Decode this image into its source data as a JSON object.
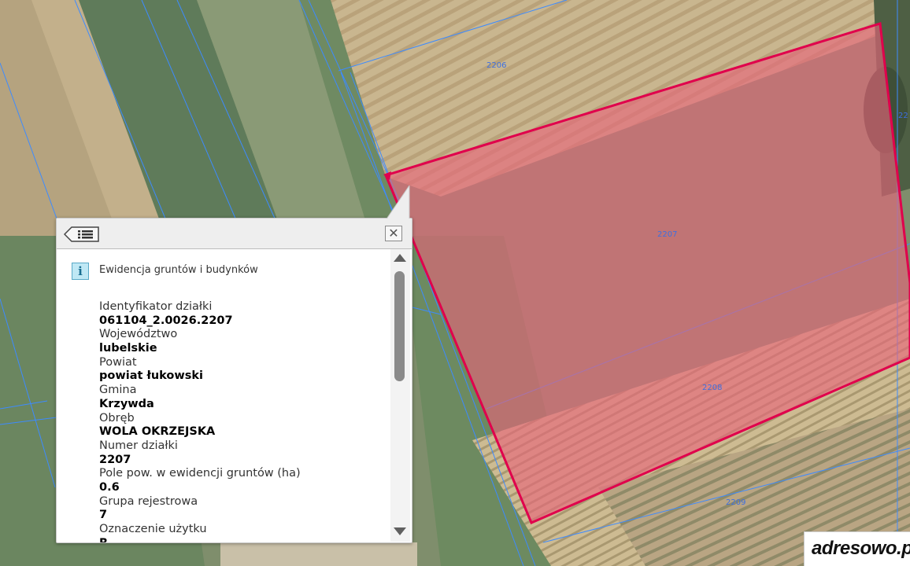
{
  "map": {
    "parcel_labels": [
      {
        "id": "label-2206-top",
        "text": "2206"
      },
      {
        "id": "label-2207",
        "text": "2207"
      },
      {
        "id": "label-2208",
        "text": "2208"
      },
      {
        "id": "label-2209",
        "text": "2209"
      },
      {
        "id": "label-22-edge",
        "text": "22"
      }
    ],
    "colors": {
      "highlight_fill": "#e8647a",
      "highlight_stroke": "#e0004c",
      "parcel_line": "#3d8bff"
    }
  },
  "popup": {
    "back_icon": "list-back-icon",
    "close_icon": "close-icon",
    "close_glyph": "✕",
    "info_glyph": "i",
    "section_title": "Ewidencja gruntów i budynków",
    "fields": [
      {
        "label": "Identyfikator działki",
        "value": "061104_2.0026.2207"
      },
      {
        "label": "Województwo",
        "value": "lubelskie"
      },
      {
        "label": "Powiat",
        "value": "powiat łukowski"
      },
      {
        "label": "Gmina",
        "value": "Krzywda"
      },
      {
        "label": "Obręb",
        "value": "WOLA OKRZEJSKA"
      },
      {
        "label": "Numer działki",
        "value": "2207"
      },
      {
        "label": "Pole pow. w ewidencji gruntów (ha)",
        "value": "0.6"
      },
      {
        "label": "Grupa rejestrowa",
        "value": "7"
      },
      {
        "label": "Oznaczenie użytku",
        "value": "R"
      }
    ]
  },
  "logo": {
    "text": "adresowo.pl"
  }
}
